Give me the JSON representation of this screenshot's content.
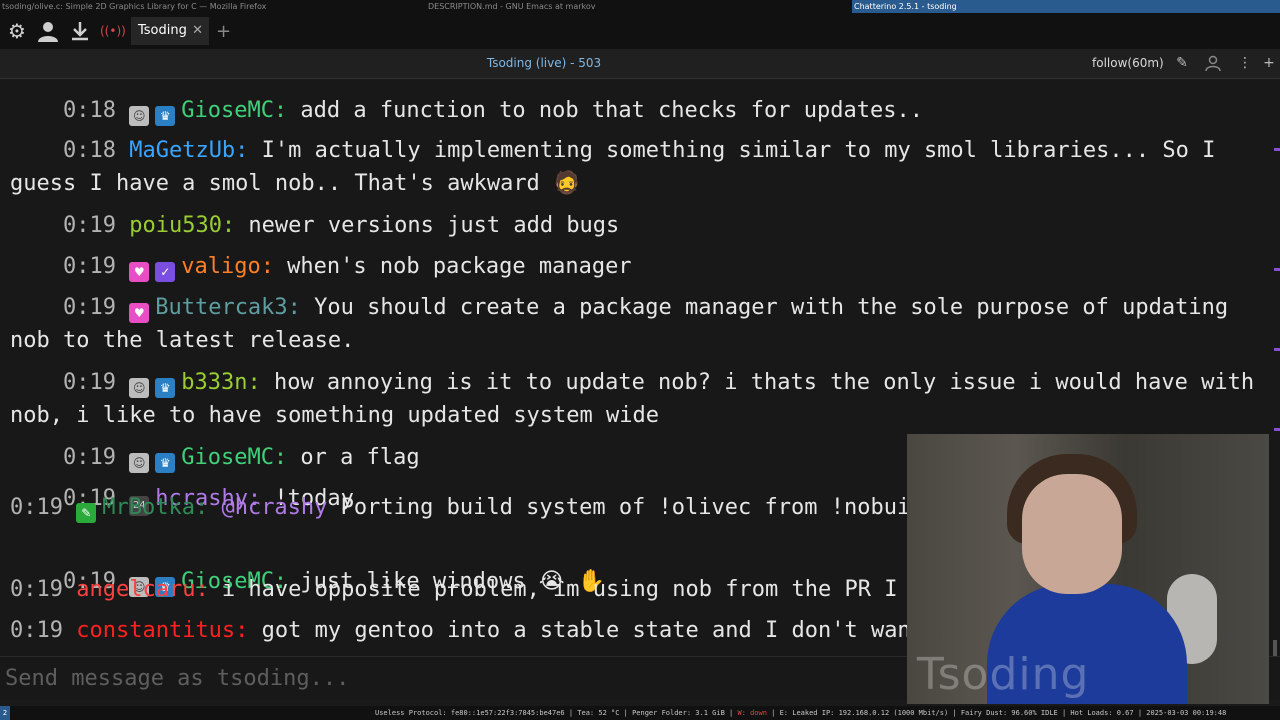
{
  "wm": {
    "left_title": "tsoding/olive.c: Simple 2D Graphics Library for C — Mozilla Firefox",
    "mid_title": "DESCRIPTION.md - GNU Emacs at markov",
    "right_title": "Chatterino 2.5.1 - tsoding"
  },
  "toolbar": {
    "tab_label": "Tsoding",
    "tab_close": "✕",
    "add_tab": "+"
  },
  "header": {
    "title": "Tsoding (live) - 503",
    "follow": "follow(60m)"
  },
  "messages": [
    {
      "time": "0:18",
      "user": "GioseMC:",
      "text": " add a function to nob that checks for updates..",
      "color": "#3fd17a"
    },
    {
      "time": "0:18",
      "user": "MaGetzUb:",
      "text": " I'm actually implementing something similar to my smol libraries... So I guess I have a smol nob.. That's awkward",
      "color": "#3aa5ff"
    },
    {
      "time": "0:19",
      "user": "poiu530:",
      "text": " newer versions just add bugs",
      "color": "#9acd32"
    },
    {
      "time": "0:19",
      "user": "valigo:",
      "text": " when's nob package manager",
      "color": "#ff7f27"
    },
    {
      "time": "0:19",
      "user": "Buttercak3:",
      "text": " You should create a package manager with the sole purpose of updating nob to the latest release.",
      "color": "#5f9ea0"
    },
    {
      "time": "0:19",
      "user": "b333n:",
      "text": " how annoying is it to update nob? i thats the only issue i would have with nob, i like to have something updated system wide",
      "color": "#9acd32"
    },
    {
      "time": "0:19",
      "user": "GioseMC:",
      "text": " or a flag",
      "color": "#3fd17a"
    },
    {
      "time": "0:19",
      "user": "hcrashy:",
      "text": " !today",
      "color": "#b07ae8"
    },
    {
      "time": "0:19",
      "user": "MrBotka:",
      "mention": "@hcrashy",
      "text": " Porting build system of !olivec from !nobuild to !nob",
      "color": "#2e8b57"
    },
    {
      "time": "0:19",
      "user": "GioseMC:",
      "text": " just like windows",
      "color": "#3fd17a"
    },
    {
      "time": "0:19",
      "user": "angelcaru:",
      "text": " i have opposite problem, im using nob from the PR I made",
      "color": "#ff4040"
    },
    {
      "time": "0:19",
      "user": "constantitus:",
      "text": " got my gentoo into a stable state and I don't want to update",
      "color": "#ff2020"
    }
  ],
  "emotes": {
    "awkward": "🧔",
    "crying": "😭",
    "hand": "✋"
  },
  "input": {
    "placeholder": "Send message as tsoding..."
  },
  "cam": {
    "watermark": "Tsoding"
  },
  "status": {
    "workspace": "2",
    "line_a": "Useless Protocol: fe80::1e57:22f3:7845:be47e6 | Tea: 52 °C | Penger Folder: 3.1 GiB | ",
    "line_warn": "W: down",
    "line_b": " | E: Leaked IP: 192.168.0.12 (1000 Mbit/s) | Fairy Dust: 96.60% IDLE | Hot Loads: 0.67 | 2025-03-03 00:19:48"
  }
}
